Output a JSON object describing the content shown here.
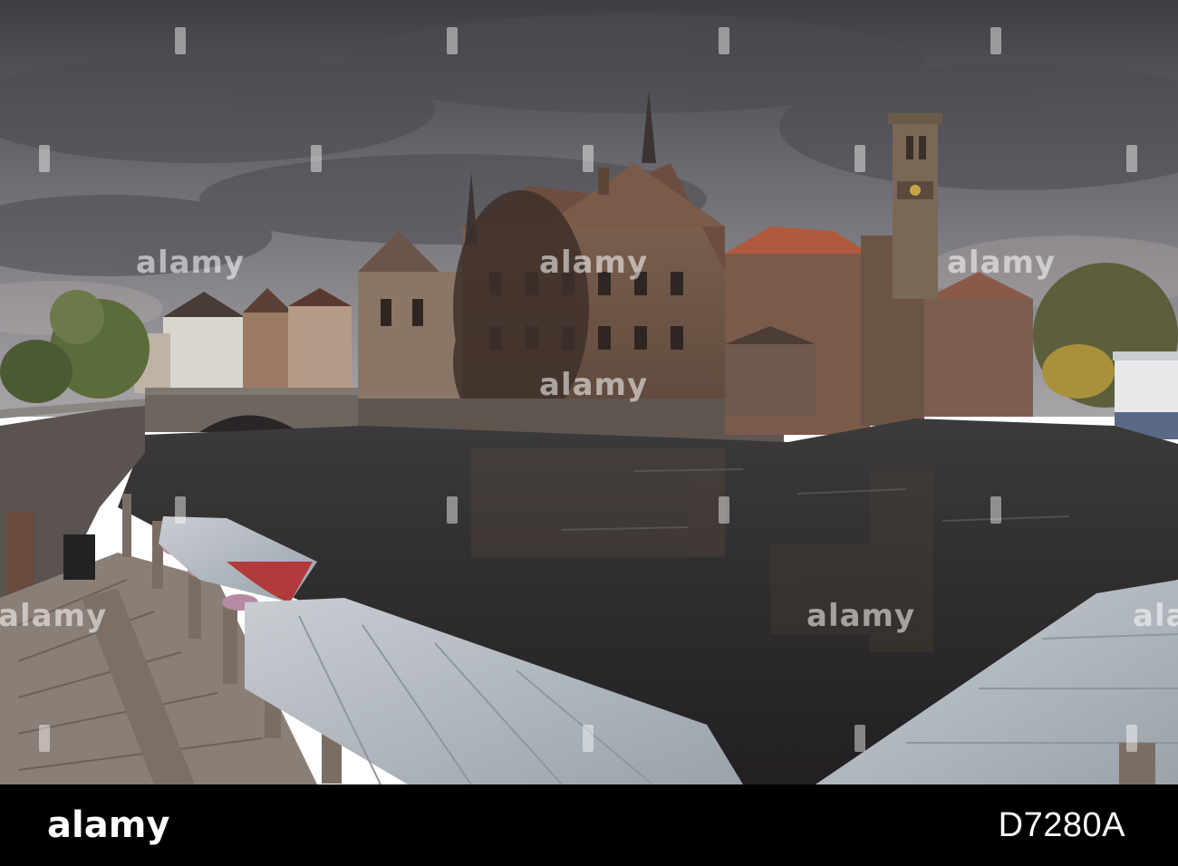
{
  "watermark": {
    "text": "alamy",
    "color": "#ffffff"
  },
  "footer": {
    "logo": "alamy",
    "image_id": "D7280A",
    "background": "#000000"
  },
  "scene": {
    "sky": "overcast-grey",
    "water": "canal-dark",
    "icons": [
      "belfry-tower",
      "canal-houses",
      "stone-bridge",
      "tour-boats",
      "wooden-jetty",
      "willow-tree"
    ]
  }
}
